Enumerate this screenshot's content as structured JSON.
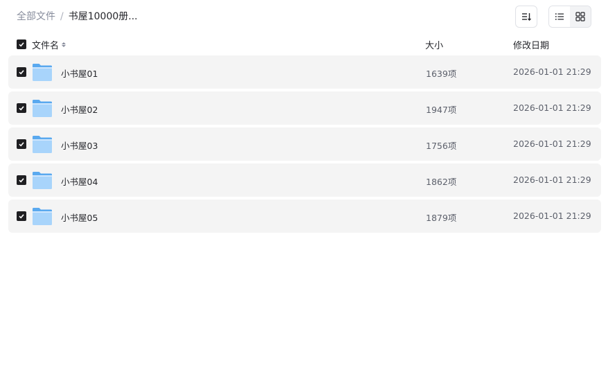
{
  "breadcrumb": {
    "root": "全部文件",
    "separator": "/",
    "current": "书屋10000册..."
  },
  "toolbar": {
    "sort_icon": "sort-icon",
    "list_view_icon": "list-view-icon",
    "grid_view_icon": "grid-view-icon",
    "active_view": "list"
  },
  "table": {
    "columns": {
      "name": "文件名",
      "size": "大小",
      "modified": "修改日期"
    },
    "select_all_checked": true,
    "rows": [
      {
        "name": "小书屋01",
        "size": "1639项",
        "modified": "2026-01-01 21:29",
        "checked": true,
        "icon": "folder-icon"
      },
      {
        "name": "小书屋02",
        "size": "1947项",
        "modified": "2026-01-01 21:29",
        "checked": true,
        "icon": "folder-icon"
      },
      {
        "name": "小书屋03",
        "size": "1756项",
        "modified": "2026-01-01 21:29",
        "checked": true,
        "icon": "folder-icon"
      },
      {
        "name": "小书屋04",
        "size": "1862项",
        "modified": "2026-01-01 21:29",
        "checked": true,
        "icon": "folder-icon"
      },
      {
        "name": "小书屋05",
        "size": "1879项",
        "modified": "2026-01-01 21:29",
        "checked": true,
        "icon": "folder-icon"
      }
    ]
  },
  "colors": {
    "row_background": "#f4f4f4",
    "checkbox": "#1f1f22",
    "folder_light": "#a8d4fb",
    "folder_dark": "#5aa9ef",
    "muted_text": "#878c9c"
  }
}
